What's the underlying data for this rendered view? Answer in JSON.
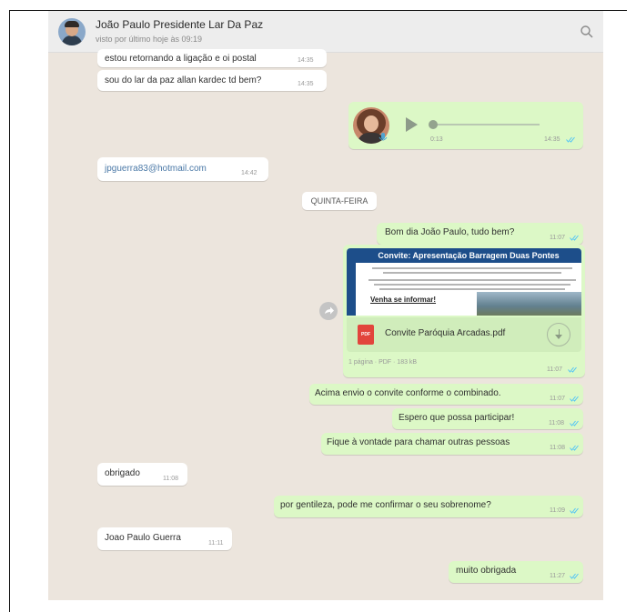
{
  "header": {
    "contact_name": "João Paulo Presidente Lar Da Paz",
    "last_seen": "visto por último hoje às 09:19"
  },
  "messages": [
    {
      "dir": "in",
      "text": "estou retornando a ligação e oi postal",
      "time": "14:35"
    },
    {
      "dir": "in",
      "text": "sou do lar da paz allan kardec td bem?",
      "time": "14:35"
    },
    {
      "dir": "out",
      "type": "voice",
      "duration": "0:13",
      "time": "14:35"
    },
    {
      "dir": "in",
      "text": "jpguerra83@hotmail.com",
      "time": "14:42"
    },
    {
      "dir": "out",
      "text": "Bom dia João Paulo, tudo bem?",
      "time": "11:07"
    },
    {
      "dir": "out",
      "type": "document",
      "preview_title": "Convite: Apresentação Barragem Duas Pontes",
      "preview_cta": "Venha se informar!",
      "filename": "Convite Paróquia Arcadas.pdf",
      "meta": "1 página · PDF · 183 kB",
      "time": "11:07"
    },
    {
      "dir": "out",
      "text": "Acima envio o convite conforme o combinado.",
      "time": "11:07"
    },
    {
      "dir": "out",
      "text": "Espero que possa participar!",
      "time": "11:08"
    },
    {
      "dir": "out",
      "text": "Fique à vontade para chamar outras pessoas",
      "time": "11:08"
    },
    {
      "dir": "in",
      "text": "obrigado",
      "time": "11:08"
    },
    {
      "dir": "out",
      "text": "por gentileza, pode me confirmar o seu sobrenome?",
      "time": "11:09"
    },
    {
      "dir": "in",
      "text": "Joao Paulo Guerra",
      "time": "11:11"
    },
    {
      "dir": "out",
      "text": "muito obrigada",
      "time": "11:27"
    }
  ],
  "date_divider": "QUINTA-FEIRA",
  "colors": {
    "chat_background": "#ece5dd",
    "outgoing_bubble": "#dcf8c6",
    "incoming_bubble": "#ffffff",
    "read_ticks": "#4fc3f7",
    "pdf_badge": "#e2453c"
  }
}
